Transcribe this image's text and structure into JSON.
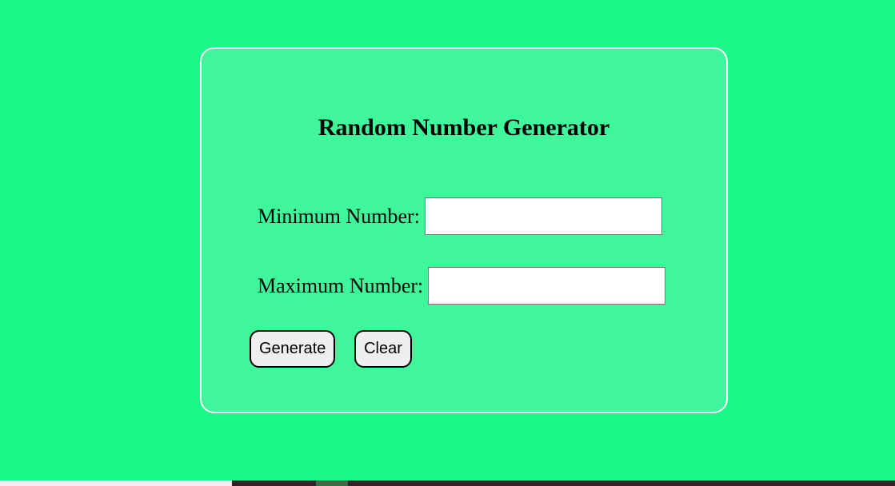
{
  "app": {
    "title": "Random Number Generator",
    "min_label": "Minimum Number:",
    "min_value": "",
    "max_label": "Maximum Number:",
    "max_value": "",
    "generate_label": "Generate",
    "clear_label": "Clear"
  },
  "colors": {
    "background": "#1af88a",
    "card": "#3ff79a",
    "card_border": "#ffffff"
  }
}
